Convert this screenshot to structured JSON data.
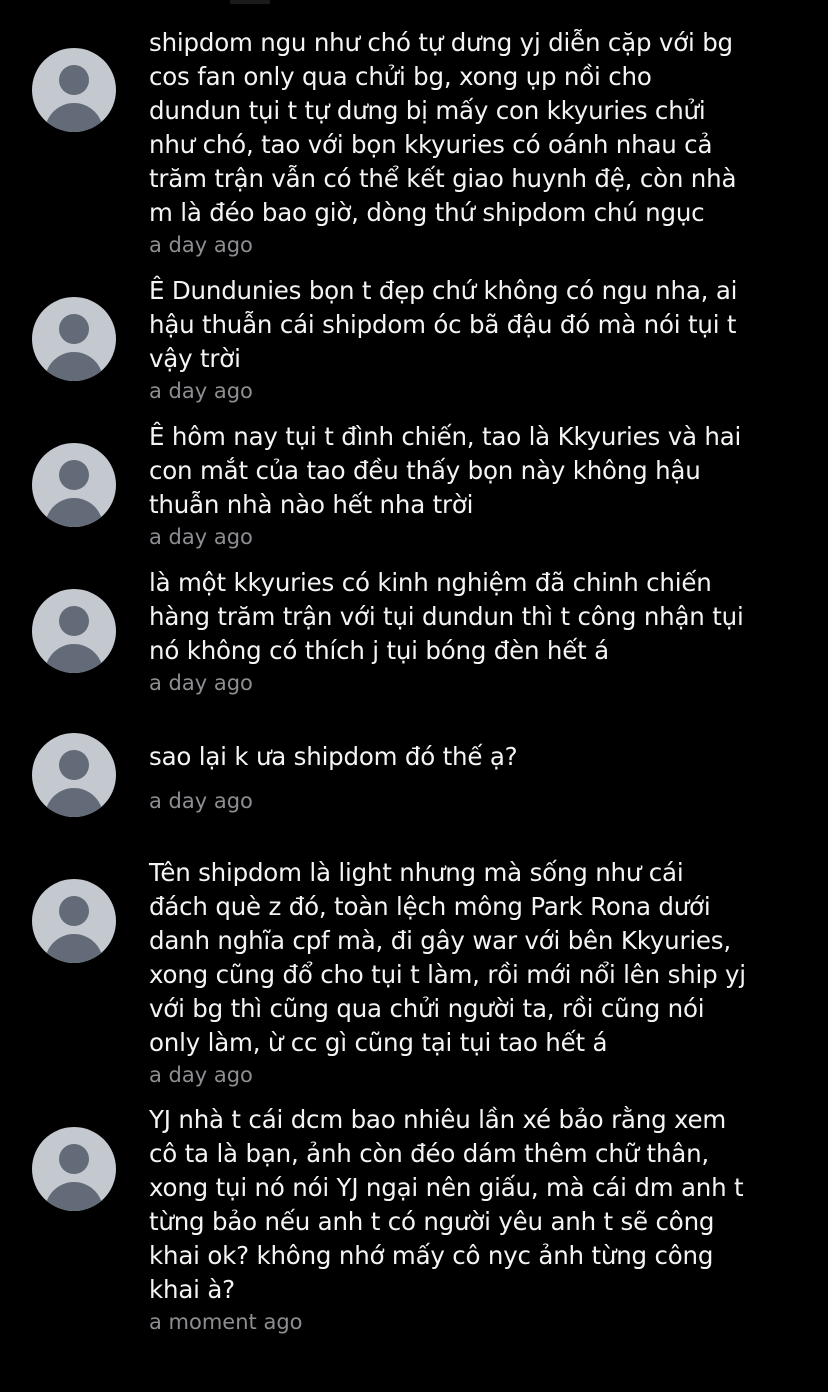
{
  "theme": {
    "background": "#000000",
    "text": "#f4f4f4",
    "timestamp": "#8d8d92",
    "avatar_bg": "#c4c8cf",
    "avatar_fg": "#636b78"
  },
  "comments": [
    {
      "text": "shipdom ngu như chó tự dưng yj diễn cặp với bg\ncos fan only qua chửi bg, xong ụp nồi cho\ndundun tụi t tự dưng bị mấy con kkyuries chửi\nnhư chó, tao với bọn kkyuries có oánh nhau cả\ntrăm trận vẫn có thể kết giao huynh đệ, còn nhà\nm là đéo bao giờ, dòng thứ shipdom chú ngục",
      "time": "a day ago"
    },
    {
      "text": "Ê Dundunies bọn t đẹp chứ không có ngu nha, ai\nhậu thuẫn cái shipdom óc bã đậu đó mà nói tụi t\nvậy trời",
      "time": "a day ago"
    },
    {
      "text": "Ê hôm nay tụi t đình chiến, tao là Kkyuries và hai\ncon mắt của tao đều thấy bọn này không hậu\nthuẫn nhà nào hết nha trời",
      "time": "a day ago"
    },
    {
      "text": "là một kkyuries có kinh nghiệm đã chinh chiến\nhàng trăm trận với tụi dundun thì t công nhận tụi\nnó không có thích j tụi bóng đèn hết á",
      "time": "a day ago"
    },
    {
      "text": "sao lại k ưa shipdom đó thế ạ?",
      "time": "a day ago"
    },
    {
      "text": "Tên shipdom là light nhưng mà sống như cái\nđách què z đó, toàn lệch mông Park Rona dưới\ndanh nghĩa cpf mà, đi gây war với bên Kkyuries,\nxong cũng đổ cho tụi t làm, rồi mới nổi lên ship yj\nvới bg thì cũng qua chửi người ta, rồi cũng nói\nonly làm, ừ cc gì cũng tại tụi tao hết á",
      "time": "a day ago"
    },
    {
      "text": "YJ nhà t cái dcm bao nhiêu lần xé bảo rằng xem\ncô ta là bạn, ảnh còn đéo dám thêm chữ thân,\nxong tụi nó nói YJ ngại nên giấu, mà cái dm anh t\ntừng bảo nếu anh t có người yêu anh t sẽ công\nkhai ok? không nhớ mấy cô nyc ảnh từng công\nkhai à?",
      "time": "a moment ago"
    }
  ]
}
